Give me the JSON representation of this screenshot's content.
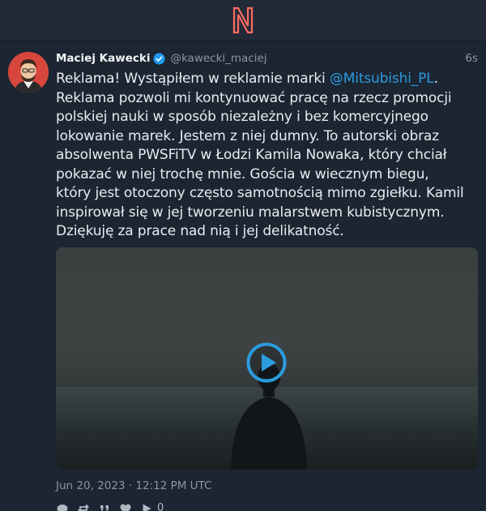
{
  "app": {
    "logo_icon": "nitter-logo-icon",
    "brand_color": "#ff6c60"
  },
  "tweet": {
    "fullname": "Maciej Kawecki",
    "username": "@kawecki_maciej",
    "time": "6s",
    "verified_icon": "verified-badge-icon",
    "content": {
      "part1": "Reklama! Wystąpiłem w reklamie marki ",
      "mention": "@Mitsubishi_PL",
      "part2": ". Reklama pozwoli mi kontynuować pracę na rzecz promocji polskiej nauki w sposób niezależny i bez komercyjnego lokowanie marek. Jestem z niej dumny. To autorski obraz absolwenta PWSFiTV w Łodzi Kamila Nowaka, który chciał pokazać w niej trochę mnie. Gościa w wiecznym biegu, który jest otoczony często samotnością mimo zgiełku. Kamil inspirował się w jej tworzeniu malarstwem kubistycznym. Dziękuję za prace nad nią i jej delikatność."
    },
    "date": "Jun 20, 2023 · 12:12 PM UTC",
    "stats": {
      "comments_icon": "comment-icon",
      "retweets_icon": "retweet-icon",
      "quotes_icon": "quote-icon",
      "likes_icon": "heart-icon",
      "plays_icon": "play-icon",
      "plays": "0"
    },
    "accent_color": "#2b9bde"
  }
}
